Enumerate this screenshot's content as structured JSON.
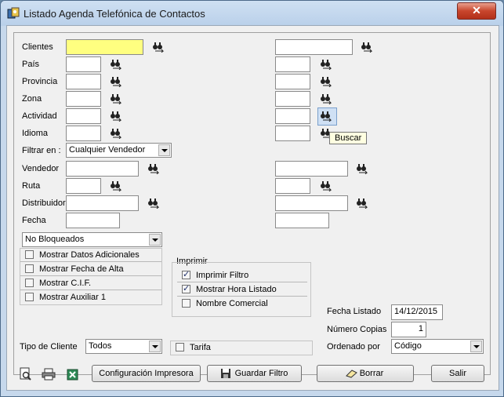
{
  "window": {
    "title": "Listado Agenda Telefónica de Contactos",
    "close": "✕"
  },
  "labels": {
    "clientes": "Clientes",
    "pais": "País",
    "provincia": "Provincia",
    "zona": "Zona",
    "actividad": "Actividad",
    "idioma": "Idioma",
    "filtrar_en": "Filtrar en :",
    "vendedor": "Vendedor",
    "ruta": "Ruta",
    "distribuidor": "Distribuidor",
    "fecha": "Fecha",
    "tipo_cliente": "Tipo de Cliente",
    "fecha_listado": "Fecha Listado",
    "numero_copias": "Número Copias",
    "ordenado_por": "Ordenado por",
    "imprimir": "Imprimir"
  },
  "fields": {
    "filtrar_en": "Cualquier Vendedor",
    "bloqueados": "No Bloqueados",
    "tipo_cliente": "Todos",
    "fecha_listado": "14/12/2015",
    "numero_copias": "1",
    "ordenado_por": "Código"
  },
  "checkboxes": {
    "datos_adicionales": {
      "label": "Mostrar Datos Adicionales",
      "checked": false
    },
    "fecha_alta": {
      "label": "Mostrar Fecha de Alta",
      "checked": false
    },
    "cif": {
      "label": "Mostrar C.I.F.",
      "checked": false
    },
    "auxiliar1": {
      "label": "Mostrar Auxiliar 1",
      "checked": false
    },
    "imprimir_filtro": {
      "label": "Imprimir Filtro",
      "checked": true
    },
    "hora_listado": {
      "label": "Mostrar Hora Listado",
      "checked": true
    },
    "nombre_comercial": {
      "label": "Nombre Comercial",
      "checked": false
    },
    "tarifa": {
      "label": "Tarifa",
      "checked": false
    }
  },
  "tooltip": "Buscar",
  "buttons": {
    "config": "Configuración Impresora",
    "guardar": "Guardar Filtro",
    "borrar": "Borrar",
    "salir": "Salir"
  },
  "icons": {
    "binoculars": "binoculars-icon",
    "preview": "print-preview-icon",
    "print": "printer-icon",
    "excel": "excel-icon"
  }
}
